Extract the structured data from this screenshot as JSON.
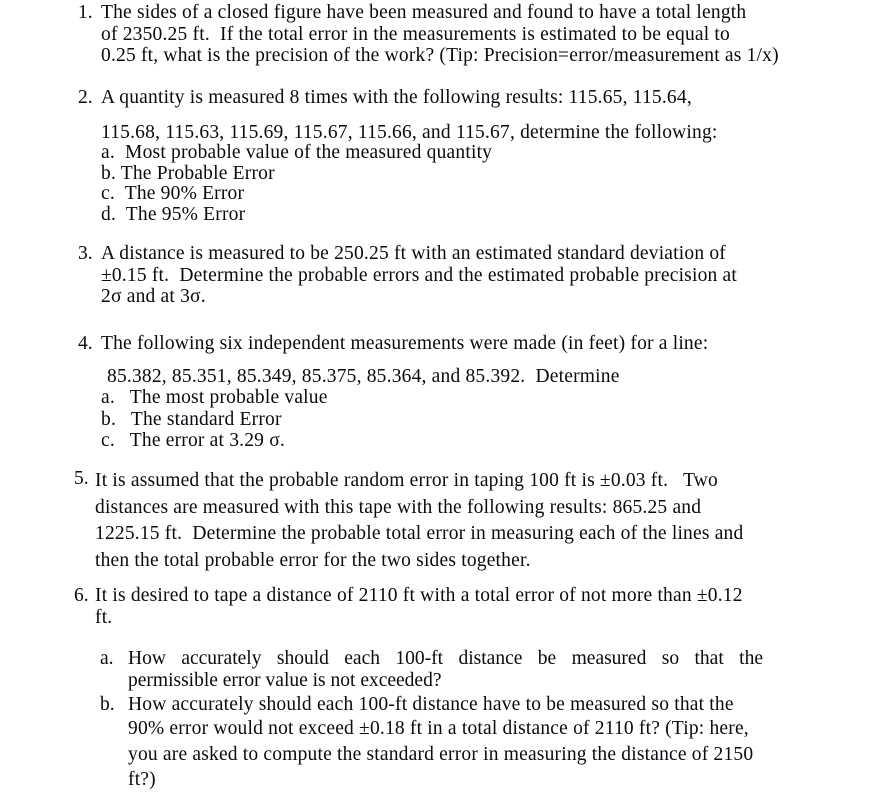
{
  "document": {
    "type": "problem-set",
    "subject": "Surveying — Errors and Precision",
    "text_color": "#0a0a10",
    "background_color": "#ffffff"
  },
  "problems": [
    {
      "number": "1.",
      "lines": [
        "The sides of a closed figure have been measured and found to have a total length",
        "of 2350.25 ft.  If the total error in the measurements is estimated to be equal to",
        "0.25 ft, what is the precision of the work? (Tip: Precision=error/measurement as 1/x)"
      ]
    },
    {
      "number": "2.",
      "lead": "A quantity is measured 8 times with the following results: 115.65, 115.64,",
      "data_line": "115.68, 115.63, 115.69, 115.67, 115.66, and 115.67, determine the following:",
      "measurements": [
        "115.65",
        "115.64",
        "115.68",
        "115.63",
        "115.69",
        "115.67",
        "115.66",
        "115.67"
      ],
      "subitems": [
        "a.  Most probable value of the measured quantity",
        "b. The Probable Error",
        "c.  The 90% Error",
        "d.  The 95% Error"
      ]
    },
    {
      "number": "3.",
      "lines": [
        "A distance is measured to be 250.25 ft with an estimated standard deviation of",
        "±0.15 ft.  Determine the probable errors and the estimated probable precision at",
        "2σ and at 3σ."
      ]
    },
    {
      "number": "4.",
      "lead": "The following six independent measurements were made (in feet) for a line:",
      "data_line": "85.382, 85.351, 85.349, 85.375, 85.364, and 85.392.  Determine",
      "measurements": [
        "85.382",
        "85.351",
        "85.349",
        "85.375",
        "85.364",
        "85.392"
      ],
      "subitems": [
        "a.   The most probable value",
        "b.   The standard Error",
        "c.   The error at 3.29 σ."
      ]
    },
    {
      "number": "5.",
      "lines": [
        "It is assumed that the probable random error in taping 100 ft is ±0.03 ft.   Two",
        "distances are measured with this tape with the following results: 865.25 and",
        "1225.15 ft.  Determine the probable total error in measuring each of the lines and",
        "then the total probable error for the two sides together."
      ]
    },
    {
      "number": "6.",
      "lines": [
        "It is desired to tape a distance of 2110 ft with a total error of not more than ±0.12",
        "ft."
      ],
      "subitems": [
        {
          "label": "a.",
          "justified_line": "How accurately should each 100-ft distance be measured so that the",
          "tail_line": "permissible error value is not exceeded?"
        },
        {
          "label": "b.",
          "lines": [
            "How accurately should each 100-ft distance have to be measured so that the",
            "90% error would not exceed ±0.18 ft in a total distance of 2110 ft? (Tip: here,",
            "you are asked to compute the standard error in measuring the distance of 2150",
            "ft?)"
          ]
        }
      ]
    }
  ]
}
